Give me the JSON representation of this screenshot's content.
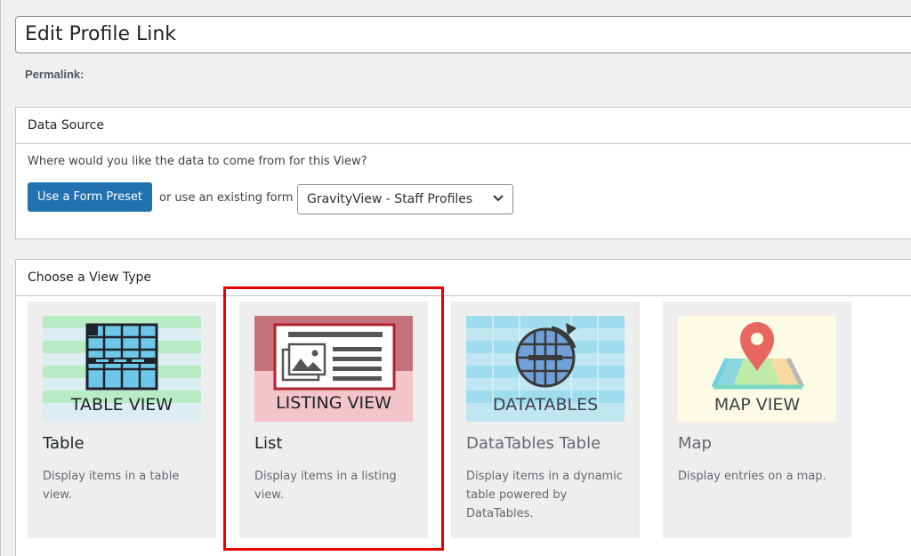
{
  "title_field": {
    "value": "Edit Profile Link"
  },
  "permalink": {
    "label": "Permalink:"
  },
  "data_source": {
    "heading": "Data Source",
    "question": "Where would you like the data to come from for this View?",
    "preset_button": "Use a Form Preset",
    "or_text": "or use an existing form",
    "form_select": {
      "selected": "GravityView - Staff Profiles"
    }
  },
  "view_type": {
    "heading": "Choose a View Type",
    "cards": [
      {
        "name": "Table",
        "thumb_label": "TABLE VIEW",
        "description": "Display items in a table view."
      },
      {
        "name": "List",
        "thumb_label": "LISTING VIEW",
        "description": "Display items in a listing view."
      },
      {
        "name": "DataTables Table",
        "thumb_label": "DATATABLES",
        "description": "Display items in a dynamic table powered by DataTables."
      },
      {
        "name": "Map",
        "thumb_label": "MAP VIEW",
        "description": "Display entries on a map."
      }
    ]
  },
  "colors": {
    "primary_button": "#2271b1",
    "highlight_border": "#e60000",
    "card_background": "#eeeeee"
  }
}
